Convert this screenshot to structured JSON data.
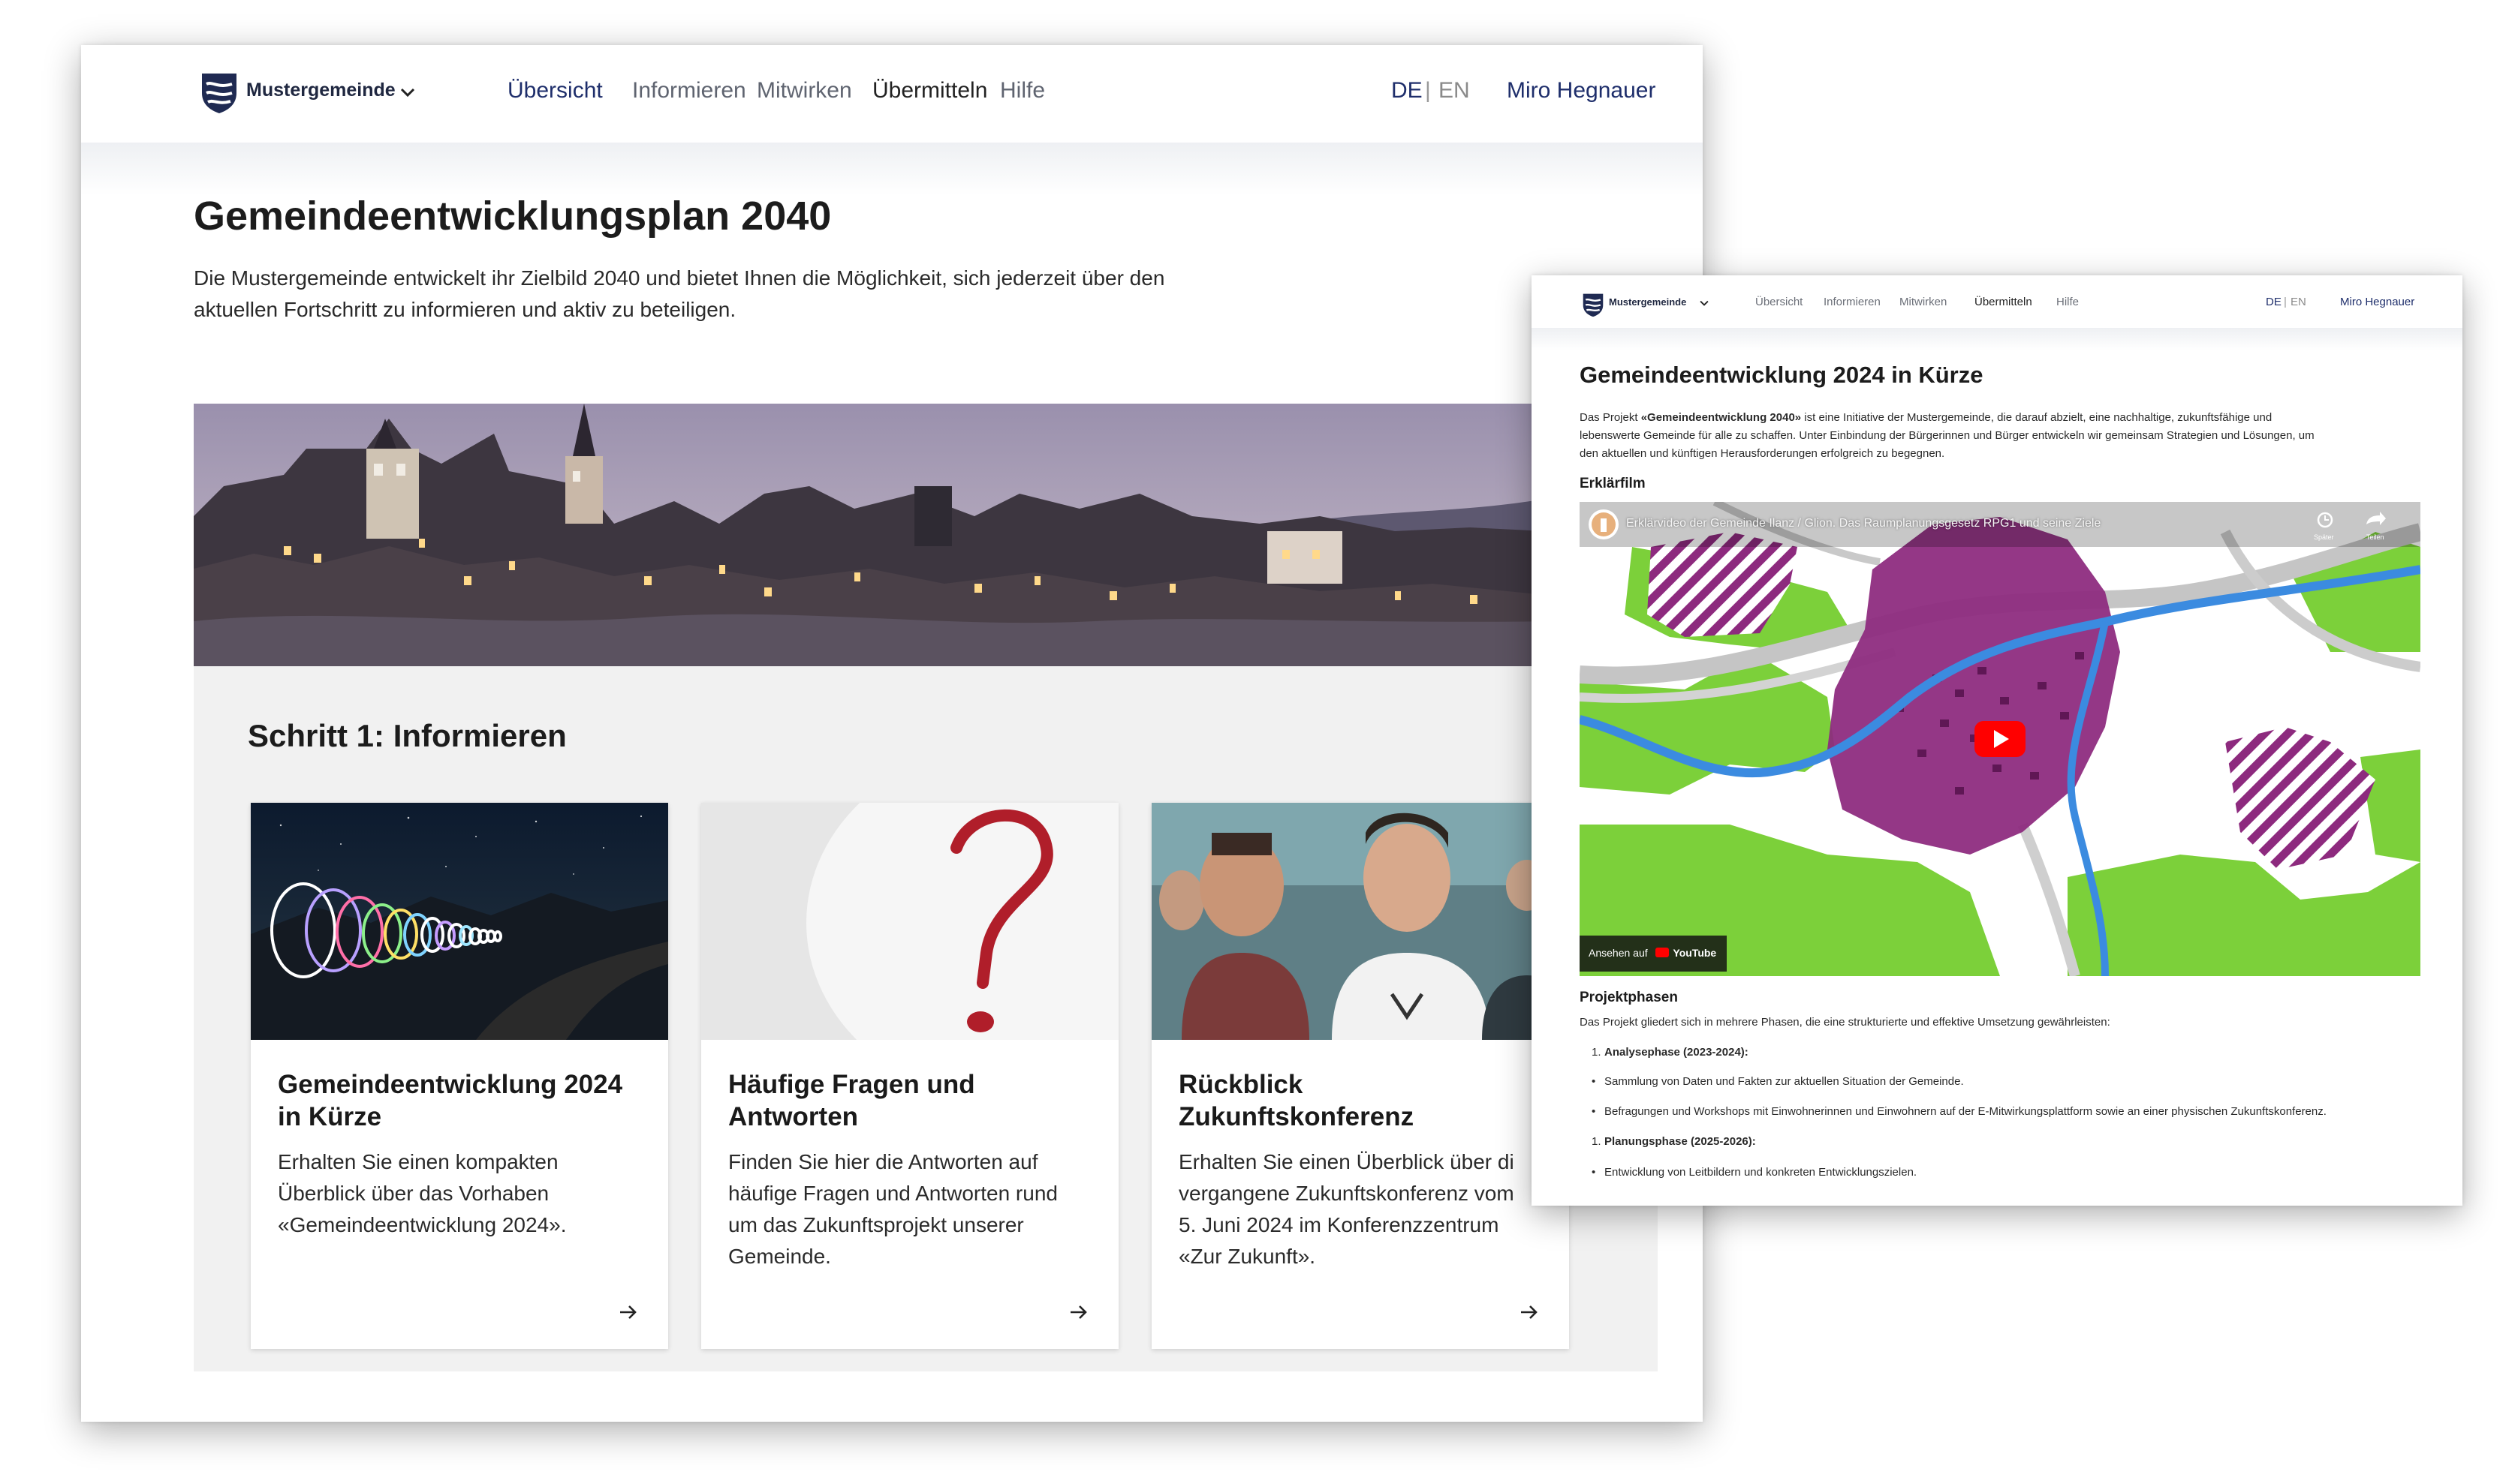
{
  "colors": {
    "accent": "#1e2e6b",
    "panel": "#f1f1f1",
    "map_purple": "#8d2a7e",
    "map_green": "#7cd03a"
  },
  "main": {
    "brand": "Mustergemeinde",
    "nav": [
      "Übersicht",
      "Informieren",
      "Mitwirken",
      "Übermitteln",
      "Hilfe"
    ],
    "lang": {
      "de": "DE",
      "sep": "|",
      "en": "EN"
    },
    "user": "Miro Hegnauer",
    "title": "Gemeindeentwicklungsplan 2040",
    "intro_1": "Die Mustergemeinde entwickelt ihr Zielbild 2040 und bietet Ihnen die Möglichkeit, sich jederzeit über den",
    "intro_2": "aktuellen Fortschritt zu informieren und aktiv zu beteiligen.",
    "step_title": "Schritt 1: Informieren",
    "cards": [
      {
        "title_1": "Gemeindeentwicklung 2024",
        "title_2": "in Kürze",
        "desc": [
          "Erhalten Sie einen kompakten",
          "Überblick über das Vorhaben",
          "«Gemeindeentwicklung 2024»."
        ]
      },
      {
        "title_1": "Häufige Fragen und",
        "title_2": "Antworten",
        "desc": [
          "Finden Sie hier die Antworten auf",
          "häufige Fragen und Antworten rund",
          "um das Zukunftsprojekt unserer",
          "Gemeinde."
        ]
      },
      {
        "title_1": "Rückblick",
        "title_2": "Zukunftskonferenz",
        "desc": [
          "Erhalten Sie einen Überblick über di",
          "vergangene Zukunftskonferenz vom",
          "5. Juni 2024 im Konferenzzentrum",
          "«Zur Zukunft»."
        ]
      }
    ]
  },
  "overlay": {
    "brand": "Mustergemeinde",
    "nav": [
      "Übersicht",
      "Informieren",
      "Mitwirken",
      "Übermitteln",
      "Hilfe"
    ],
    "lang": {
      "de": "DE",
      "sep": "|",
      "en": "EN"
    },
    "user": "Miro Hegnauer",
    "title": "Gemeindeentwicklung 2024 in Kürze",
    "intro_1a": "Das Projekt ",
    "intro_1b": "«Gemeindeentwicklung 2040»",
    "intro_1c": " ist eine Initiative der Mustergemeinde, die darauf abzielt, eine nachhaltige, zukunftsfähige und",
    "intro_2": "lebenswerte Gemeinde für alle zu schaffen. Unter Einbindung der Bürgerinnen und Bürger entwickeln wir gemeinsam Strategien und Lösungen, um",
    "intro_3": "den aktuellen und künftigen Herausforderungen erfolgreich zu begegnen.",
    "film_heading": "Erklärfilm",
    "video_title": "Erklärvideo der Gemeinde Ilanz / Glion. Das Raumplanungsgesetz RPG1 und seine Ziele",
    "video_later": "Später",
    "video_share": "Teilen",
    "watch_on": "Ansehen auf",
    "youtube": "YouTube",
    "phases_heading": "Projektphasen",
    "phases_intro": "Das Projekt gliedert sich in mehrere Phasen, die eine strukturierte und effektive Umsetzung gewährleisten:",
    "phase1": "Analysephase (2023-2024):",
    "phase1_items": [
      "Sammlung von Daten und Fakten zur aktuellen Situation der Gemeinde.",
      "Befragungen und Workshops mit Einwohnerinnen und Einwohnern auf der E-Mitwirkungsplattform sowie an einer physischen Zukunftskonferenz."
    ],
    "phase2": "Planungsphase (2025-2026):",
    "phase2_items": [
      "Entwicklung von Leitbildern und konkreten Entwicklungszielen."
    ],
    "list_num": "1."
  }
}
